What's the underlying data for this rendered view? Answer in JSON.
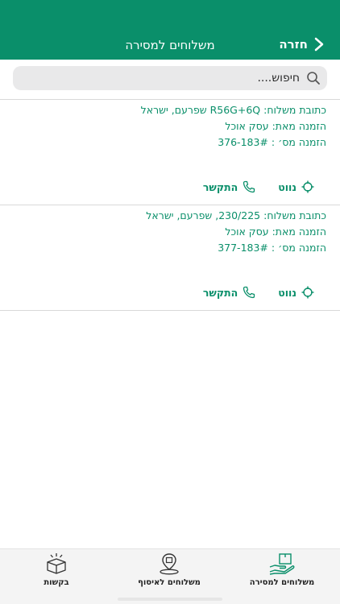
{
  "header": {
    "title": "משלוחים למסירה",
    "back_label": "חזרה"
  },
  "search": {
    "placeholder": "חיפוש....",
    "value": ""
  },
  "deliveries": [
    {
      "address": "כתובת משלוח: R56G+6Q שפרעם, ישראל",
      "from": "הזמנה מאת: עסק אוכל",
      "order": "הזמנה מס׳ : 376-183#",
      "navigate_label": "נווט",
      "call_label": "התקשר"
    },
    {
      "address": "כתובת משלוח: 230/225, שפרעם, ישראל",
      "from": "הזמנה מאת: עסק אוכל",
      "order": "הזמנה מס׳ : 377-183#",
      "navigate_label": "נווט",
      "call_label": "התקשר"
    }
  ],
  "tabs": [
    {
      "label": "משלוחים למסירה",
      "icon": "hand-box-icon",
      "active": true
    },
    {
      "label": "משלוחים לאיסוף",
      "icon": "map-pin-icon",
      "active": false
    },
    {
      "label": "בקשות",
      "icon": "open-box-icon",
      "active": false
    }
  ],
  "colors": {
    "brand": "#0a8f6a",
    "header_bg": "#0a8f6a"
  }
}
